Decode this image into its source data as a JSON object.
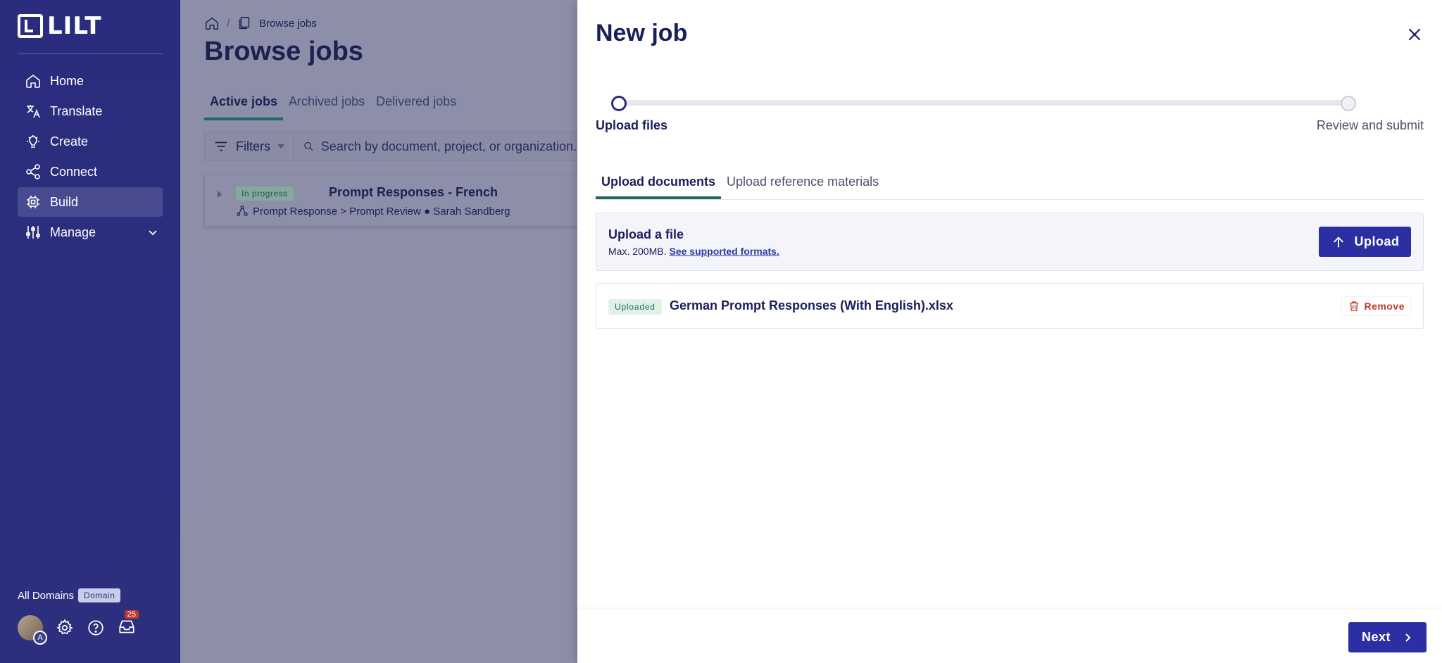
{
  "app": {
    "logo_text": "LILT"
  },
  "sidebar": {
    "items": [
      {
        "label": "Home",
        "icon": "home-icon"
      },
      {
        "label": "Translate",
        "icon": "translate-icon"
      },
      {
        "label": "Create",
        "icon": "create-icon"
      },
      {
        "label": "Connect",
        "icon": "connect-icon"
      },
      {
        "label": "Build",
        "icon": "build-icon",
        "active": true
      },
      {
        "label": "Manage",
        "icon": "manage-icon",
        "expandable": true
      }
    ],
    "domains_label": "All Domains",
    "domain_badge": "Domain",
    "avatar_initial": "A",
    "inbox_count": "25"
  },
  "main": {
    "breadcrumb": {
      "current": "Browse jobs"
    },
    "title": "Browse jobs",
    "tabs": [
      {
        "label": "Active jobs",
        "active": true
      },
      {
        "label": "Archived jobs"
      },
      {
        "label": "Delivered jobs"
      }
    ],
    "filters_label": "Filters",
    "search_placeholder": "Search by document, project, or organization...",
    "jobs": [
      {
        "status": "In progress",
        "title": "Prompt Responses - French",
        "meta": "Prompt Response > Prompt Review ● Sarah Sandberg"
      }
    ]
  },
  "modal": {
    "title": "New job",
    "steps": [
      {
        "label": "Upload files",
        "state": "current"
      },
      {
        "label": "Review and submit",
        "state": "future"
      }
    ],
    "tabs": [
      {
        "label": "Upload documents",
        "active": true
      },
      {
        "label": "Upload reference materials"
      }
    ],
    "upload": {
      "heading": "Upload a file",
      "subtext": "Max. 200MB.",
      "link": "See supported formats.",
      "button": "Upload"
    },
    "files": [
      {
        "status": "Uploaded",
        "name": "German Prompt Responses (With English).xlsx",
        "action": "Remove"
      }
    ],
    "next_label": "Next"
  },
  "colors": {
    "sidebar_bg": "#2a2d7d",
    "primary_button": "#2c2fa4",
    "accent_green": "#206a5d",
    "danger": "#c0392b"
  }
}
